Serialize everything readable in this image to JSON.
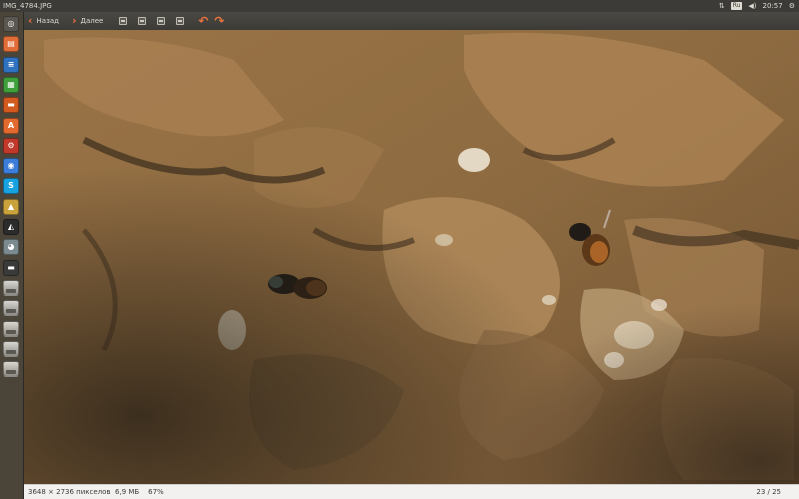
{
  "window": {
    "title": "IMG_4784.JPG"
  },
  "top_panel": {
    "keyboard_layout": "Ru",
    "clock": "20:57"
  },
  "toolbar": {
    "back_label": "Назад",
    "forward_label": "Далее"
  },
  "launcher": {
    "items": [
      {
        "name": "dash-home",
        "glyph": "◎",
        "color": "#5a5751"
      },
      {
        "name": "files",
        "glyph": "▤",
        "color": "#e06d37"
      },
      {
        "name": "libreoffice-writer",
        "glyph": "≡",
        "color": "#2f72c0"
      },
      {
        "name": "libreoffice-calc",
        "glyph": "▦",
        "color": "#3f9f3a"
      },
      {
        "name": "libreoffice-impress",
        "glyph": "▬",
        "color": "#d25a1f"
      },
      {
        "name": "ubuntu-software-center",
        "glyph": "A",
        "color": "#e36a2e"
      },
      {
        "name": "settings",
        "glyph": "⚙",
        "color": "#c0392b"
      },
      {
        "name": "chromium",
        "glyph": "◉",
        "color": "#3b7dd8"
      },
      {
        "name": "skype",
        "glyph": "S",
        "color": "#18a2e0"
      },
      {
        "name": "image-viewer",
        "glyph": "▲",
        "color": "#c9a23b"
      },
      {
        "name": "inkscape",
        "glyph": "◭",
        "color": "#2b2b2b"
      },
      {
        "name": "chrome",
        "glyph": "◕",
        "color": "#7b8a8e"
      },
      {
        "name": "usb-drive",
        "glyph": "▬",
        "color": "#3a3a3a"
      },
      {
        "name": "drive-1",
        "glyph": "",
        "color": ""
      },
      {
        "name": "drive-2",
        "glyph": "",
        "color": ""
      },
      {
        "name": "drive-3",
        "glyph": "",
        "color": ""
      },
      {
        "name": "drive-4",
        "glyph": "",
        "color": ""
      },
      {
        "name": "drive-5",
        "glyph": "",
        "color": ""
      }
    ]
  },
  "status": {
    "dimensions": "3648 × 2736 пикселов",
    "size": "6,9 МБ",
    "zoom": "67%",
    "position": "23 / 25"
  }
}
